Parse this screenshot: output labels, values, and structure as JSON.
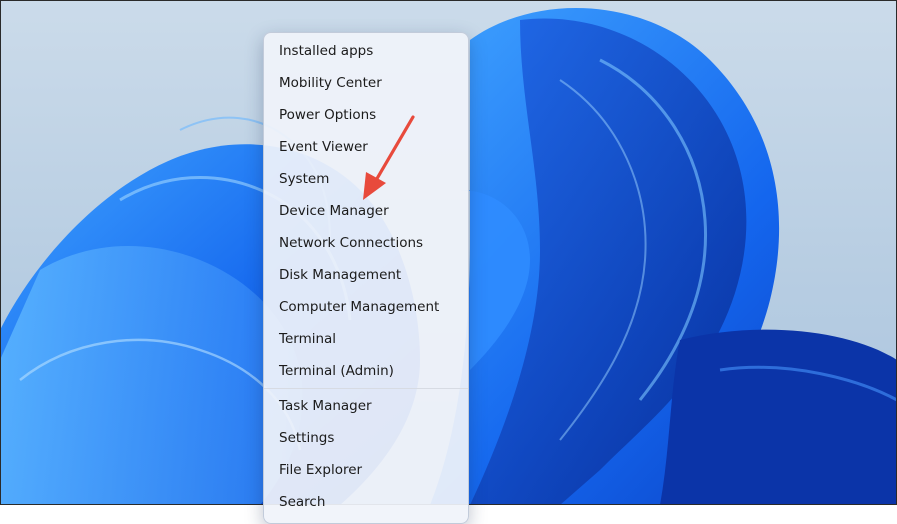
{
  "menu": {
    "items_group1": [
      {
        "label": "Installed apps"
      },
      {
        "label": "Mobility Center"
      },
      {
        "label": "Power Options"
      },
      {
        "label": "Event Viewer"
      },
      {
        "label": "System"
      },
      {
        "label": "Device Manager"
      },
      {
        "label": "Network Connections"
      },
      {
        "label": "Disk Management"
      },
      {
        "label": "Computer Management"
      },
      {
        "label": "Terminal"
      },
      {
        "label": "Terminal (Admin)"
      }
    ],
    "items_group2": [
      {
        "label": "Task Manager"
      },
      {
        "label": "Settings"
      },
      {
        "label": "File Explorer"
      },
      {
        "label": "Search"
      }
    ]
  },
  "annotation": {
    "color": "#e84a3c",
    "icon": "red-arrow-icon"
  },
  "wallpaper": {
    "name": "windows-11-bloom",
    "colors": [
      "#0a3ec2",
      "#1a6cf0",
      "#3f9bff",
      "#cbdbea"
    ]
  }
}
